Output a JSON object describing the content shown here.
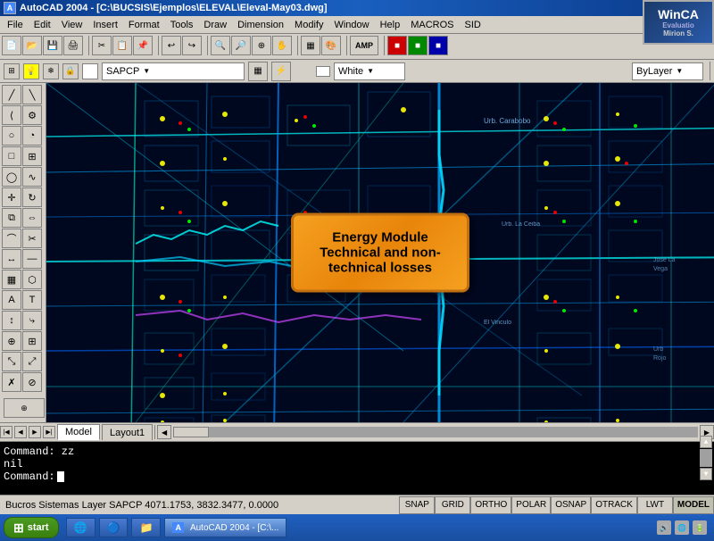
{
  "titlebar": {
    "icon": "A",
    "title": "AutoCAD 2004 - [C:\\BUCSIS\\Ejemplos\\ELEVAL\\Eleval-May03.dwg]",
    "min": "—",
    "max": "□",
    "close": "✕"
  },
  "watermark": {
    "win_text": "WinCA",
    "eval_text": "Evaluatio",
    "mirion_text": "Mirion S."
  },
  "menu": {
    "items": [
      "File",
      "Edit",
      "View",
      "Insert",
      "Format",
      "Tools",
      "Draw",
      "Dimension",
      "Modify",
      "Window",
      "Help",
      "MACROS",
      "SID"
    ]
  },
  "layer_toolbar": {
    "layer_name": "SAPCP",
    "color_name": "White",
    "linetype": "ByLayer"
  },
  "popup": {
    "line1": "Energy Module",
    "line2": "Technical and non-",
    "line3": "technical losses"
  },
  "tabs": {
    "items": [
      "Model",
      "Layout1"
    ]
  },
  "command": {
    "line1": "Command: zz",
    "line2": "nil",
    "line3": "Command:"
  },
  "status": {
    "info": "Bucros Sistemas Layer SAPCP  4071.1753, 3832.3477, 0.0000",
    "buttons": [
      "SNAP",
      "GRID",
      "ORTHO",
      "POLAR",
      "OSNAP",
      "OTRACK",
      "LWT",
      "MODEL"
    ]
  },
  "taskbar": {
    "start": "start",
    "items": [
      {
        "icon": "A",
        "label": "AutoCAD 2004 - [C:\\..."
      }
    ],
    "time": "..."
  },
  "toolbar1_buttons": [
    "📁",
    "💾",
    "🖨",
    "✂",
    "📋",
    "🔙",
    "🔄",
    "🔍",
    "?",
    "□",
    "🔲",
    "🔳",
    "▫",
    "◽",
    "▪"
  ],
  "toolbar2_buttons": [
    "↩",
    "↪",
    "💡",
    "📐",
    "⊕",
    "🔍",
    "🔍",
    "◻",
    "🔶",
    "🔷",
    "⚙",
    "🔌",
    "📊",
    "🖊",
    "⚡"
  ]
}
